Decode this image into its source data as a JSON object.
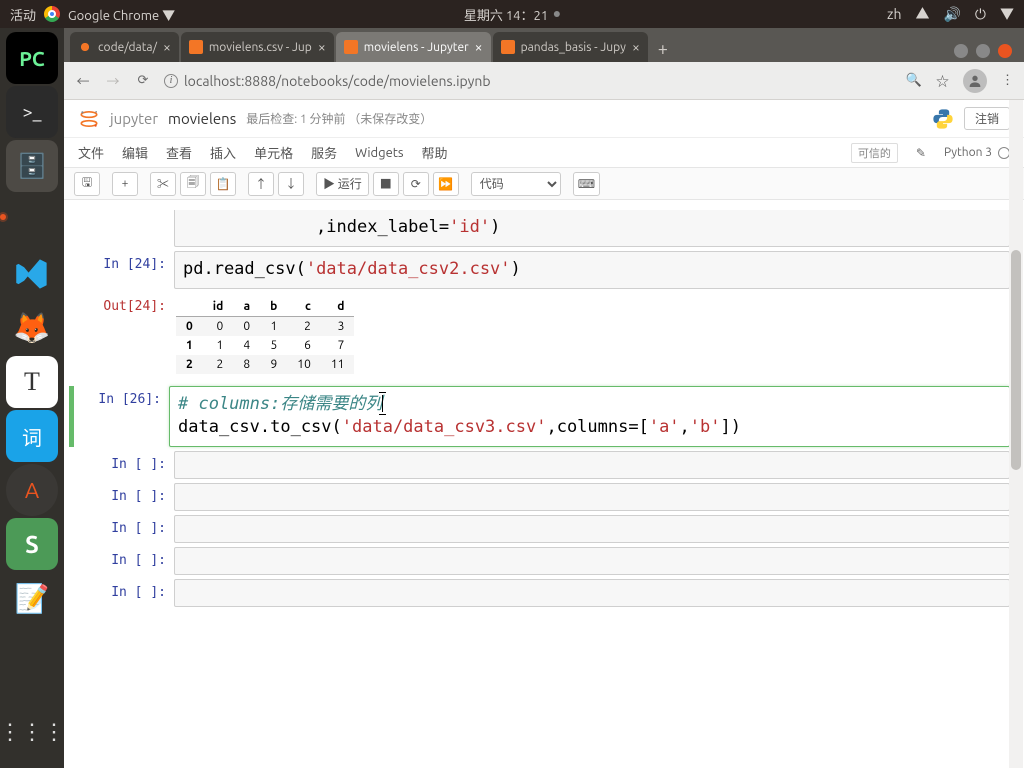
{
  "sysbar": {
    "activities": "活动",
    "app": "Google Chrome",
    "datetime": "星期六 14：21",
    "lang": "zh"
  },
  "tabs": [
    {
      "title": "code/data/",
      "active": false
    },
    {
      "title": "movielens.csv - Jup",
      "active": false
    },
    {
      "title": "movielens - Jupyter",
      "active": true
    },
    {
      "title": "pandas_basis - Jupy",
      "active": false
    }
  ],
  "url": "localhost:8888/notebooks/code/movielens.ipynb",
  "jupyter": {
    "brand": "jupyter",
    "notebook": "movielens",
    "checkpoint": "最后检查: 1 分钟前 （未保存改变）",
    "logout": "注销",
    "menus": [
      "文件",
      "编辑",
      "查看",
      "插入",
      "单元格",
      "服务",
      "Widgets",
      "帮助"
    ],
    "trusted": "可信的",
    "kernel": "Python 3",
    "toolbar": {
      "save": "💾",
      "add": "+",
      "cut": "✂",
      "copy": "⧉",
      "paste": "📋",
      "up": "↑",
      "down": "↓",
      "run": "▶ 运行",
      "stop": "■",
      "restart": "↻",
      "ff": "⏩",
      "celltype": "代码",
      "cmd": "⌘"
    }
  },
  "cells": {
    "partial_prompt": "",
    "partial_code_display": "             ,index_label='id')",
    "c24_prompt": "In [24]:",
    "c24_code": "pd.read_csv('data/data_csv2.csv')",
    "c24_out_prompt": "Out[24]:",
    "c26_prompt": "In [26]:",
    "c26_comment": "# columns:存储需要的列",
    "c26_code": "data_csv.to_csv('data/data_csv3.csv',columns=['a','b'])",
    "empty_prompt": "In [ ]:"
  },
  "chart_data": {
    "type": "table",
    "columns": [
      "id",
      "a",
      "b",
      "c",
      "d"
    ],
    "index": [
      0,
      1,
      2
    ],
    "rows": [
      [
        0,
        0,
        1,
        2,
        3
      ],
      [
        1,
        4,
        5,
        6,
        7
      ],
      [
        2,
        8,
        9,
        10,
        11
      ]
    ]
  }
}
